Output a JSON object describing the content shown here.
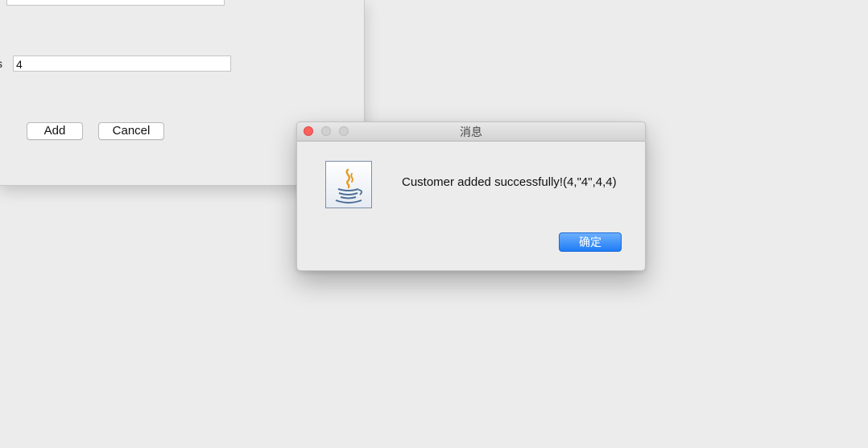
{
  "background_form": {
    "label_partial": "s",
    "field_1_value": "",
    "field_2_value": "4",
    "add_button_label": "Add",
    "cancel_button_label": "Cancel"
  },
  "dialog": {
    "title": "消息",
    "icon": "java-icon",
    "message": "Customer added successfully!(4,\"4\",4,4)",
    "ok_button_label": "确定",
    "accent_color": "#1f7cf5"
  }
}
